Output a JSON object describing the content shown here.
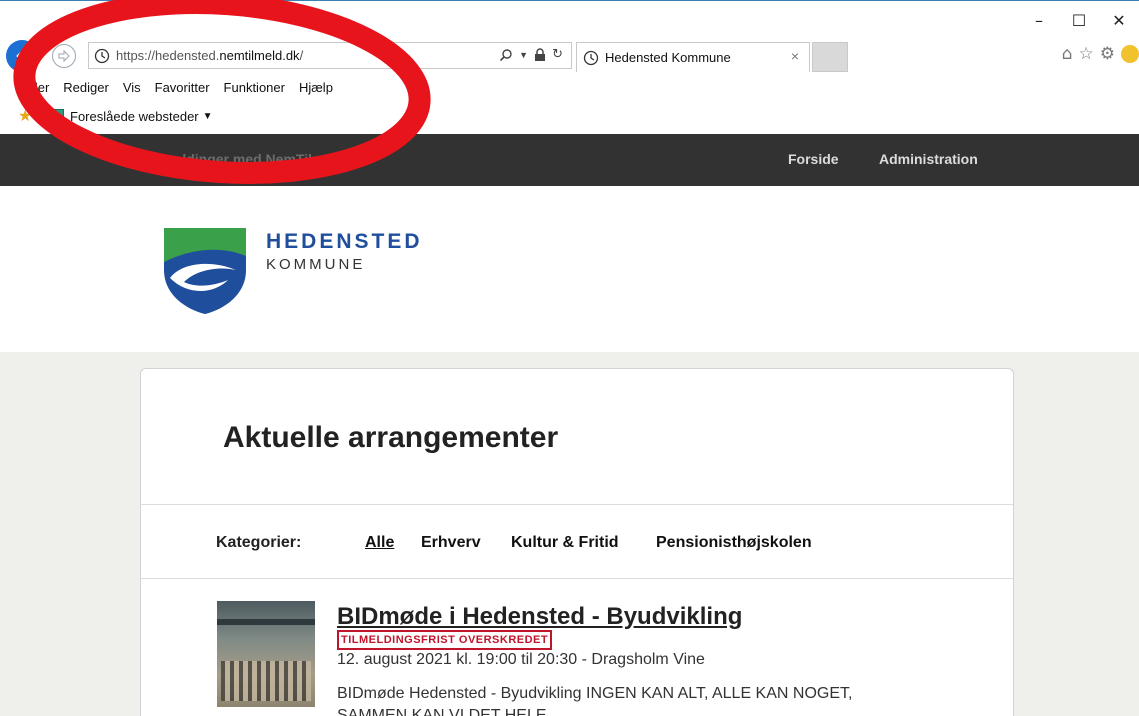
{
  "browser": {
    "address": {
      "prefix": "https://hedensted.",
      "domain": "nemtilmeld.dk",
      "suffix": "/"
    },
    "tab_title": "Hedensted Kommune",
    "tab_close": "×",
    "window_controls": {
      "minimize": "–",
      "maximize": "☐",
      "close": "✕"
    },
    "menu": [
      "Filer",
      "Rediger",
      "Vis",
      "Favoritter",
      "Funktioner",
      "Hjælp"
    ],
    "favorites": {
      "suggested_label": "Foreslåede websteder"
    }
  },
  "site": {
    "brand": "Tilmeldinger med NemTilmeld",
    "nav": {
      "home": "Forside",
      "admin": "Administration"
    },
    "logo": {
      "line1": "HEDENSTED",
      "line2": "KOMMUNE"
    }
  },
  "main": {
    "title": "Aktuelle arrangementer",
    "categories_label": "Kategorier:",
    "categories": [
      "Alle",
      "Erhverv",
      "Kultur & Fritid",
      "Pensionisthøjskolen"
    ],
    "active_category": "Alle",
    "events": [
      {
        "title": "BIDmøde i Hedensted - Byudvikling",
        "badge": "TILMELDINGSFRIST OVERSKREDET",
        "date": "12. august 2021 kl. 19:00 til 20:30 - Dragsholm Vine",
        "description_line1": "BIDmøde Hedensted - Byudvikling INGEN KAN ALT, ALLE KAN NOGET,",
        "description_line2": "SAMMEN KAN VI DET HELE"
      }
    ]
  },
  "colors": {
    "annotation": "#e8141c",
    "site_nav_bg": "#323232",
    "badge": "#c0142b",
    "page_bg": "#efefeb",
    "logo_blue": "#1f4e9d",
    "logo_green": "#3aa04a"
  }
}
